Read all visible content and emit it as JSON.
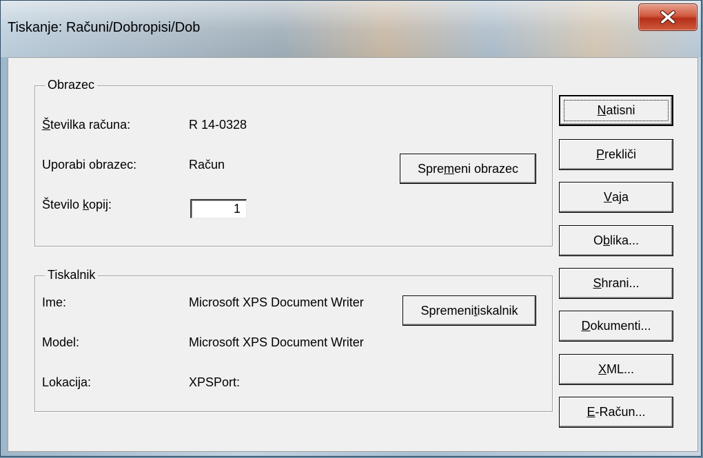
{
  "window": {
    "title": "Tiskanje: Računi/Dobropisi/Dob",
    "close_glyph": "X"
  },
  "form_group": {
    "title": "Obrazec",
    "invoice_number_label_first": "Š",
    "invoice_number_label_rest": "tevilka računa:",
    "invoice_number_value": "R 14-0328",
    "use_form_label": "Uporabi obrazec:",
    "use_form_value": "Račun",
    "copies_label_before": "Število ",
    "copies_label_accel": "k",
    "copies_label_after": "opij:",
    "copies_value": "1",
    "change_form_before": "Spre",
    "change_form_accel": "m",
    "change_form_after": "eni obrazec"
  },
  "printer_group": {
    "title": "Tiskalnik",
    "name_label": "Ime:",
    "name_value": "Microsoft XPS Document Writer",
    "model_label": "Model:",
    "model_value": "Microsoft XPS Document Writer",
    "location_label": "Lokacija:",
    "location_value": "XPSPort:",
    "change_printer_before": "Spremeni ",
    "change_printer_accel": "t",
    "change_printer_after": "iskalnik"
  },
  "side_buttons": [
    {
      "before": "",
      "accel": "N",
      "after": "atisni"
    },
    {
      "before": "",
      "accel": "P",
      "after": "rekliči"
    },
    {
      "before": "",
      "accel": "V",
      "after": "aja"
    },
    {
      "before": "O",
      "accel": "b",
      "after": "lika..."
    },
    {
      "before": "",
      "accel": "S",
      "after": "hrani..."
    },
    {
      "before": "",
      "accel": "D",
      "after": "okumenti..."
    },
    {
      "before": "",
      "accel": "X",
      "after": "ML..."
    },
    {
      "before": "",
      "accel": "E",
      "after": "-Račun..."
    }
  ]
}
